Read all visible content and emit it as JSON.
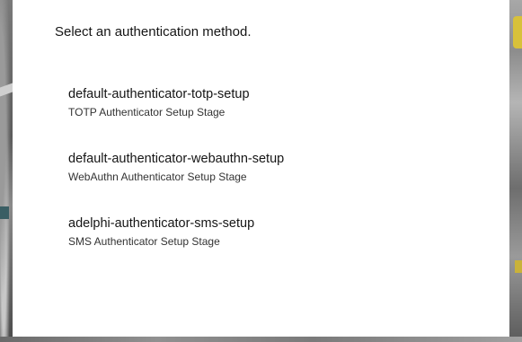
{
  "dialog": {
    "title": "Select an authentication method."
  },
  "methods": [
    {
      "name": "default-authenticator-totp-setup",
      "description": "TOTP Authenticator Setup Stage"
    },
    {
      "name": "default-authenticator-webauthn-setup",
      "description": "WebAuthn Authenticator Setup Stage"
    },
    {
      "name": "adelphi-authenticator-sms-setup",
      "description": "SMS Authenticator Setup Stage"
    }
  ],
  "colors": {
    "card_background": "#ffffff",
    "text_primary": "#151515",
    "text_secondary": "#333333",
    "backdrop": "#6e6e6e"
  }
}
